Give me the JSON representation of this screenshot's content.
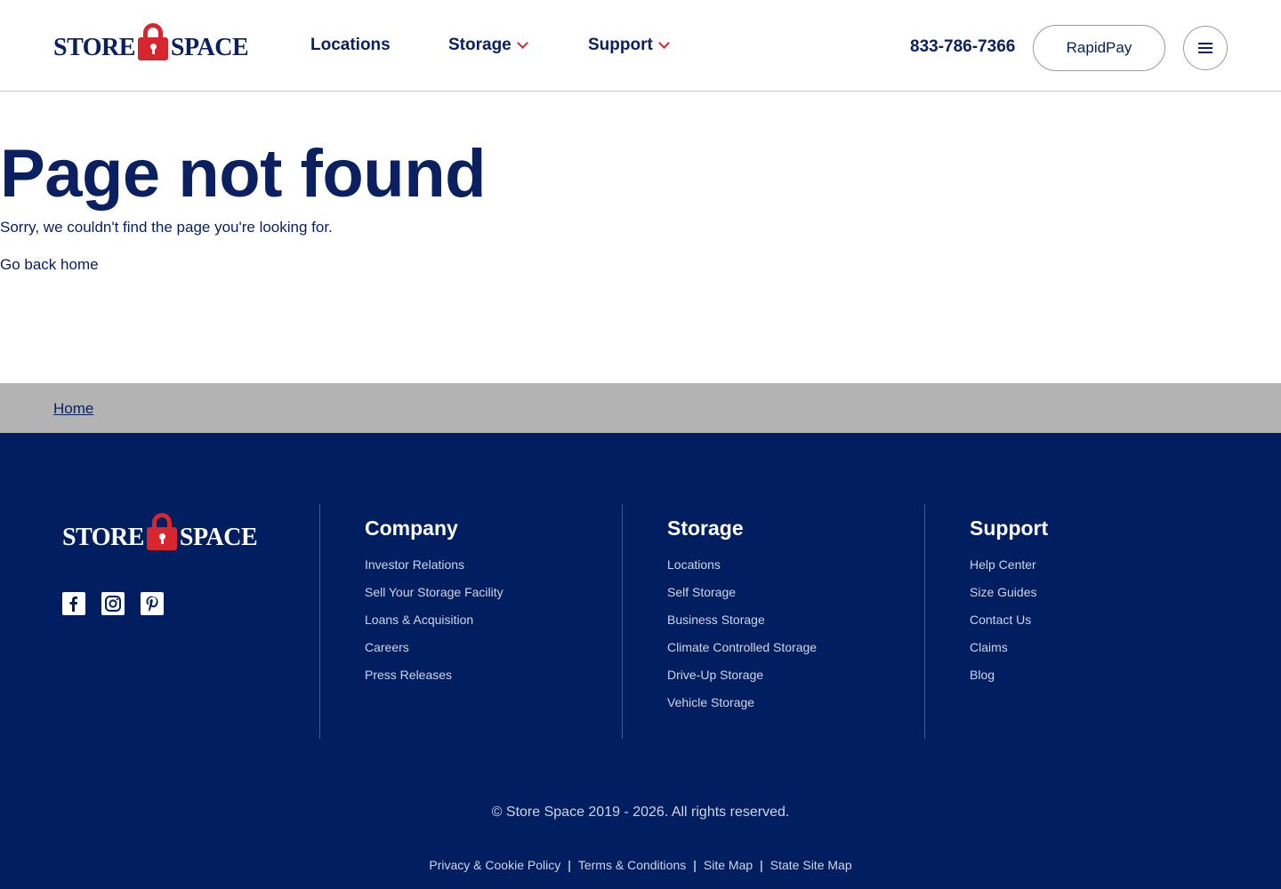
{
  "brand": {
    "word_left": "STORE",
    "word_right": "SPACE",
    "colors": {
      "navy": "#0b2060",
      "footer_bg": "#001e60",
      "red": "#d7262e",
      "crumb_bg": "#b3b3b3"
    }
  },
  "header": {
    "nav": [
      {
        "label": "Locations",
        "has_dropdown": false
      },
      {
        "label": "Storage",
        "has_dropdown": true,
        "icon": "chevron-down-icon"
      },
      {
        "label": "Support",
        "has_dropdown": true,
        "icon": "chevron-down-icon"
      }
    ],
    "phone": "833-786-7366",
    "rapidpay_label": "RapidPay",
    "menu_icon": "hamburger-icon"
  },
  "main": {
    "title": "Page not found",
    "subtitle": "Sorry, we couldn't find the page you're looking for.",
    "back_link": "Go back home"
  },
  "breadcrumb": {
    "home": "Home"
  },
  "footer": {
    "social": [
      "facebook-icon",
      "instagram-icon",
      "pinterest-icon"
    ],
    "columns": [
      {
        "title": "Company",
        "items": [
          "Investor Relations",
          "Sell Your Storage Facility",
          "Loans & Acquisition",
          "Careers",
          "Press Releases"
        ]
      },
      {
        "title": "Storage",
        "items": [
          "Locations",
          "Self Storage",
          "Business Storage",
          "Climate Controlled Storage",
          "Drive-Up Storage",
          "Vehicle Storage"
        ]
      },
      {
        "title": "Support",
        "items": [
          "Help Center",
          "Size Guides",
          "Contact Us",
          "Claims",
          "Blog"
        ]
      }
    ],
    "copyright": "© Store Space 2019 - 2026. All rights reserved.",
    "legal": [
      "Privacy & Cookie Policy",
      "Terms & Conditions",
      "Site Map",
      "State Site Map"
    ],
    "legal_separator": "|"
  }
}
